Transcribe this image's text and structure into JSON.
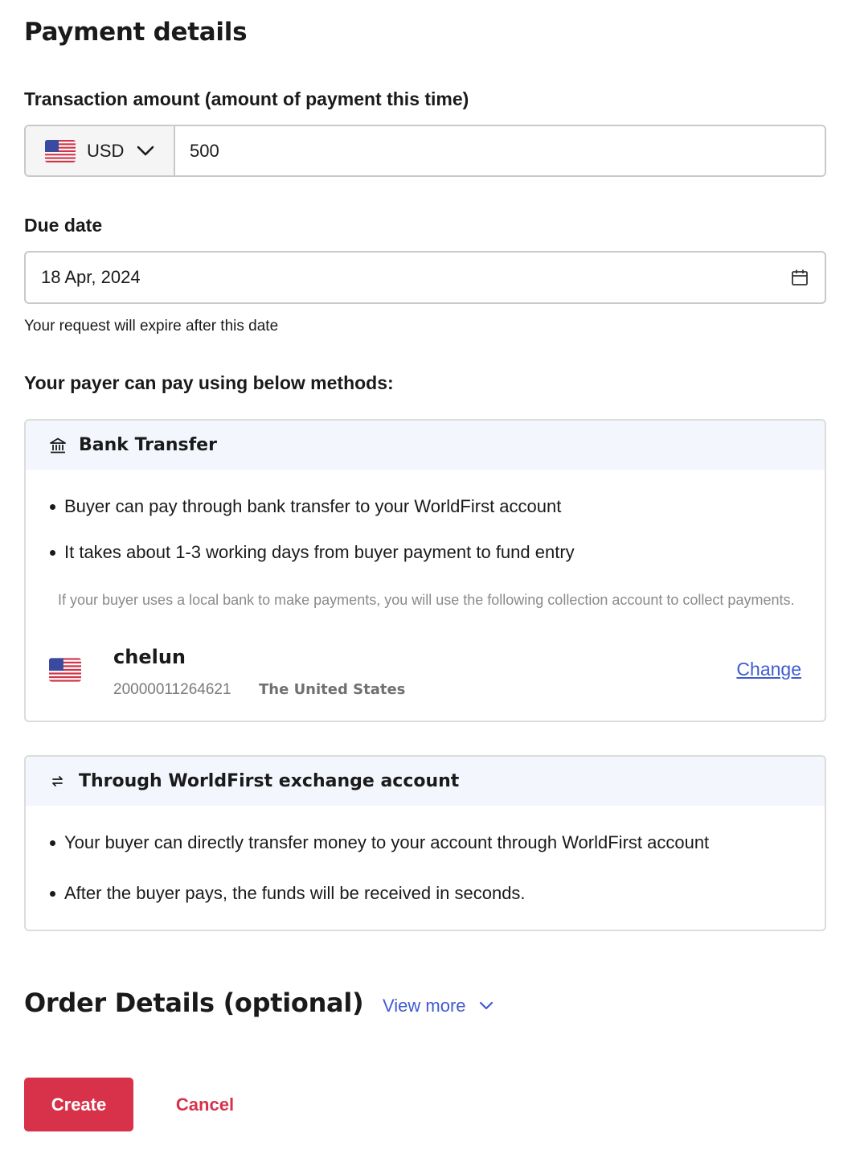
{
  "page": {
    "title": "Payment details"
  },
  "amount": {
    "label": "Transaction amount (amount of payment this time)",
    "currency_flag": "us-flag-icon",
    "currency": "USD",
    "value": "500"
  },
  "due_date": {
    "label": "Due date",
    "value": "18 Apr, 2024",
    "hint": "Your request will expire after this date"
  },
  "methods": {
    "heading": "Your payer can pay using below methods:",
    "bank_transfer": {
      "icon": "bank-icon",
      "title": "Bank Transfer",
      "bullets": [
        "Buyer can pay through bank transfer to your WorldFirst account",
        "It takes about 1-3 working days from buyer payment to fund entry"
      ],
      "note": "If your buyer uses a local bank to make payments, you will use the following collection account to collect payments.",
      "account": {
        "name": "chelun",
        "number": "20000011264621",
        "country": "The United States",
        "change_label": "Change"
      }
    },
    "exchange": {
      "icon": "exchange-arrows-icon",
      "title": "Through WorldFirst exchange account",
      "bullets": [
        "Your buyer can directly transfer money to your account through WorldFirst account",
        "After the buyer pays, the funds will be received in seconds."
      ]
    }
  },
  "order_details": {
    "title": "Order Details (optional)",
    "view_more": "View more"
  },
  "actions": {
    "create": "Create",
    "cancel": "Cancel"
  },
  "colors": {
    "accent": "#3f5bd1",
    "primary": "#d8324a",
    "card_header": "#f3f6fd"
  }
}
